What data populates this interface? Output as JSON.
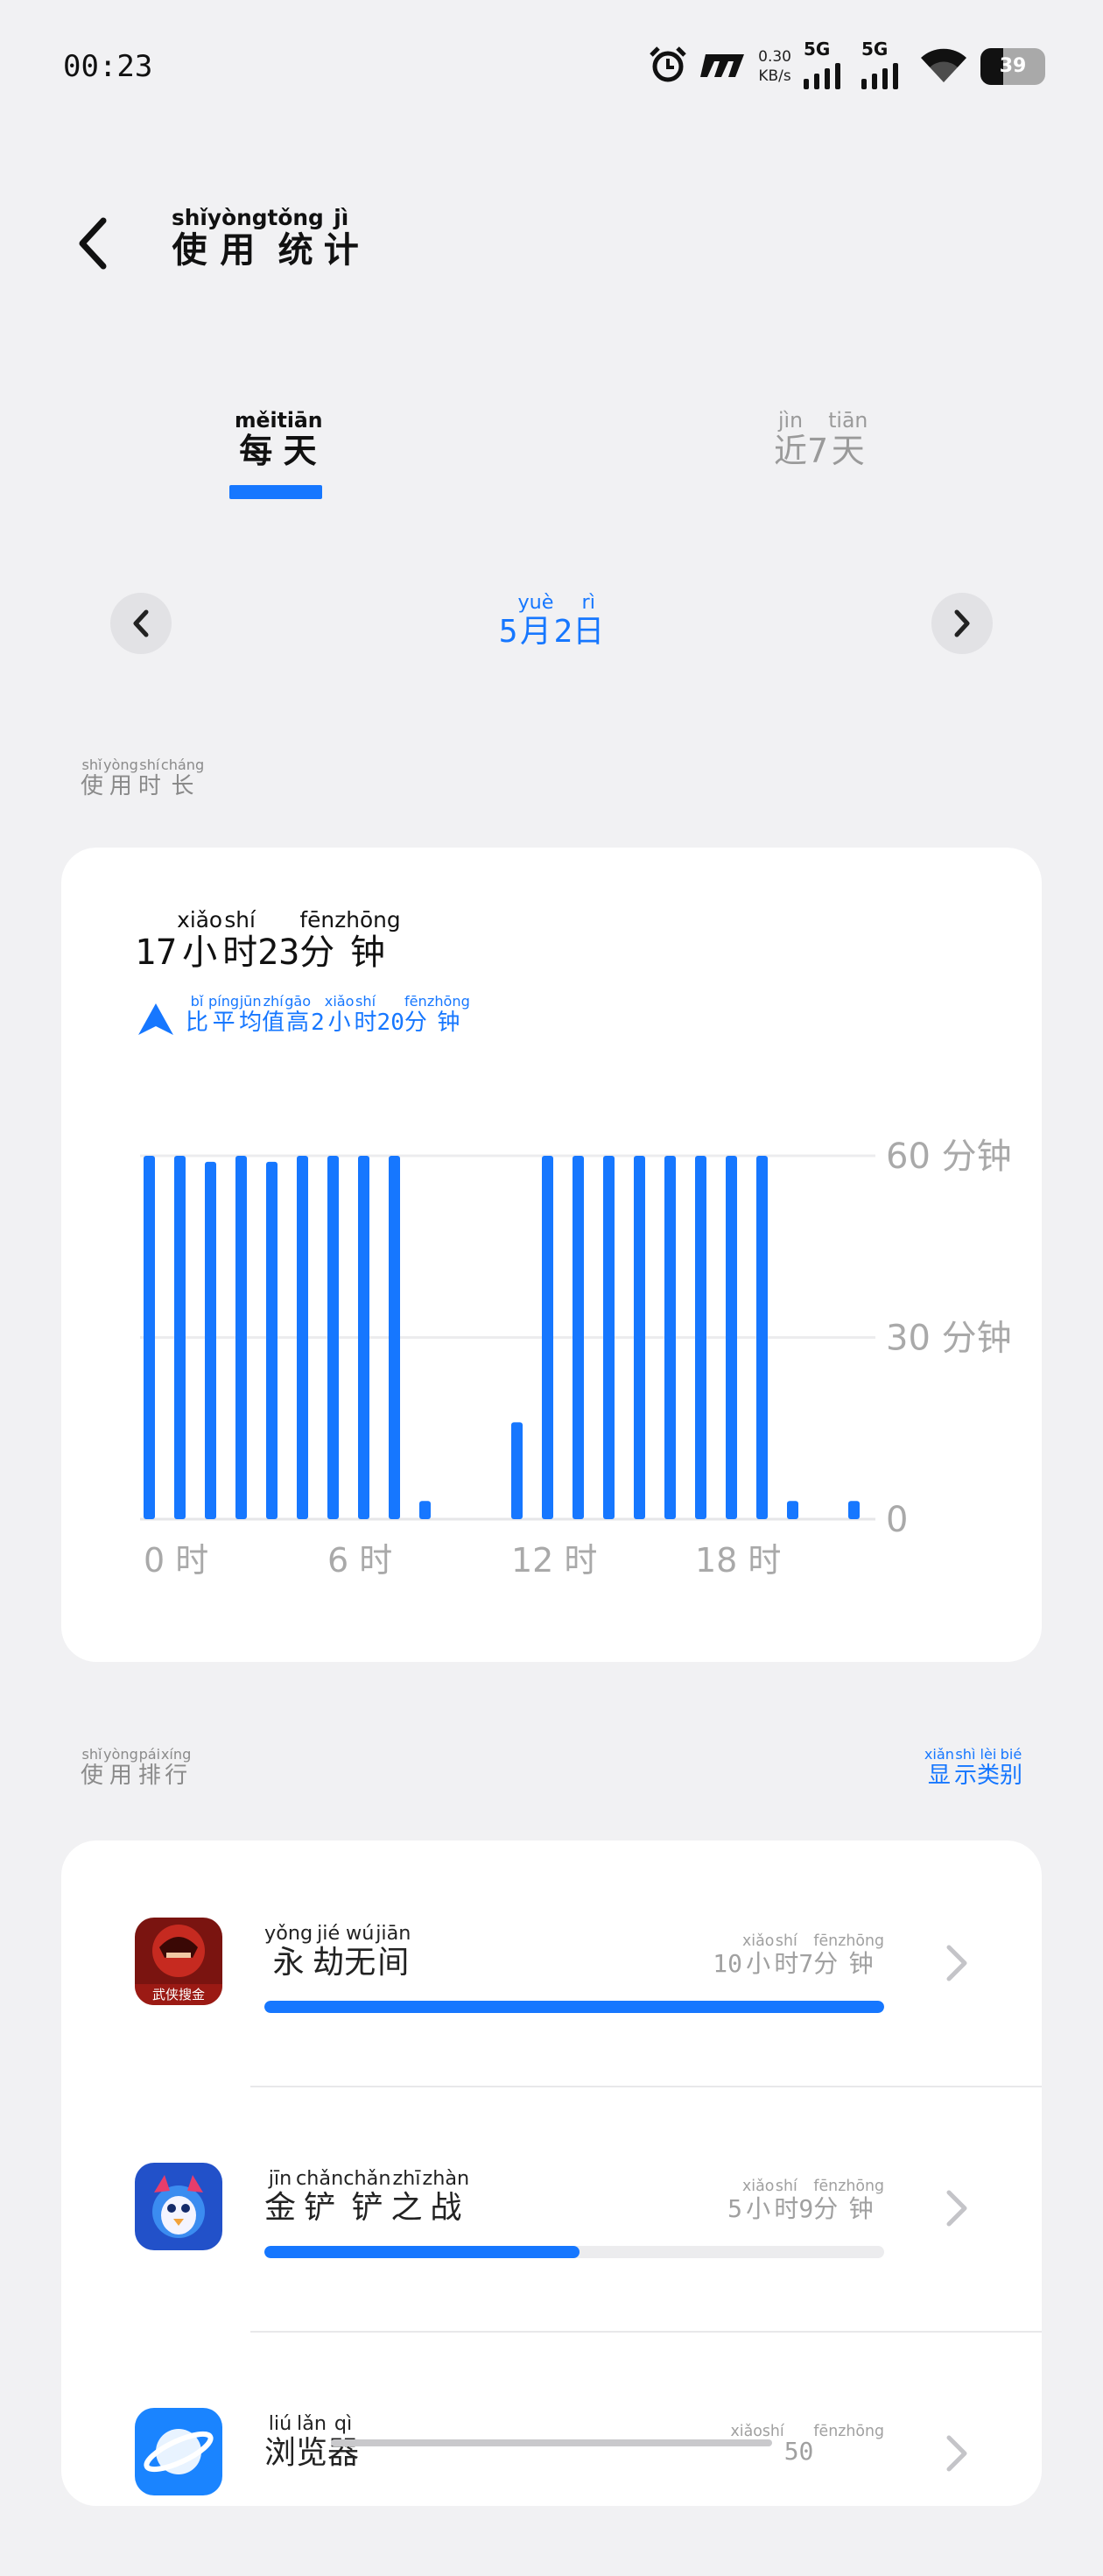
{
  "status_bar": {
    "time": "00:23",
    "net_speed_value": "0.30",
    "net_speed_unit": "KB/s",
    "signal1_label": "5G",
    "signal2_label": "5G",
    "battery": "39"
  },
  "header": {
    "title_chars": [
      "使",
      "用",
      "统",
      "计"
    ],
    "title_pinyin": [
      "shǐ",
      "yòng",
      "tǒng",
      "jì"
    ]
  },
  "tabs": [
    {
      "chars": [
        "每",
        "天"
      ],
      "pinyin": [
        "měi",
        "tiān"
      ],
      "active": true
    },
    {
      "chars": [
        "近",
        "7",
        "天"
      ],
      "pinyin": [
        "jìn",
        "",
        "tiān"
      ],
      "active": false
    }
  ],
  "date_nav": {
    "parts": [
      {
        "t": "5",
        "p": ""
      },
      {
        "t": "月",
        "p": "yuè"
      },
      {
        "t": "2",
        "p": ""
      },
      {
        "t": "日",
        "p": "rì"
      }
    ]
  },
  "usage_section": {
    "label": [
      {
        "t": "使",
        "p": "shǐ"
      },
      {
        "t": "用",
        "p": "yòng"
      },
      {
        "t": "时",
        "p": "shí"
      },
      {
        "t": "长",
        "p": "cháng"
      }
    ],
    "total": [
      {
        "t": "17",
        "p": ""
      },
      {
        "t": "小",
        "p": "xiǎo"
      },
      {
        "t": "时",
        "p": "shí"
      },
      {
        "t": "23",
        "p": ""
      },
      {
        "t": "分",
        "p": "fēn"
      },
      {
        "t": "钟",
        "p": "zhōng"
      }
    ],
    "compare": [
      {
        "t": "比",
        "p": "bǐ"
      },
      {
        "t": "平",
        "p": "píng"
      },
      {
        "t": "均",
        "p": "jūn"
      },
      {
        "t": "值",
        "p": "zhí"
      },
      {
        "t": "高",
        "p": "gāo"
      },
      {
        "t": "2",
        "p": ""
      },
      {
        "t": "小",
        "p": "xiǎo"
      },
      {
        "t": "时",
        "p": "shí"
      },
      {
        "t": "20",
        "p": ""
      },
      {
        "t": "分",
        "p": "fēn"
      },
      {
        "t": "钟",
        "p": "zhōng"
      }
    ],
    "compare_direction": "up"
  },
  "chart_data": {
    "type": "bar",
    "categories": [
      "0",
      "1",
      "2",
      "3",
      "4",
      "5",
      "6",
      "7",
      "8",
      "9",
      "10",
      "11",
      "12",
      "13",
      "14",
      "15",
      "16",
      "17",
      "18",
      "19",
      "20",
      "21",
      "22",
      "23"
    ],
    "values": [
      60,
      60,
      59,
      60,
      59,
      60,
      60,
      60,
      60,
      3,
      0,
      0,
      16,
      60,
      60,
      60,
      60,
      60,
      60,
      60,
      60,
      3,
      0,
      3
    ],
    "y_tick_labels": [
      "60 分钟",
      "30 分钟",
      "0"
    ],
    "y_ticks": [
      60,
      30,
      0
    ],
    "x_tick_labels": [
      "0 时",
      "6 时",
      "12 时",
      "18 时"
    ],
    "x_tick_positions": [
      0,
      6,
      12,
      18
    ],
    "ylim": [
      0,
      60
    ],
    "bar_color": "#1677ff",
    "grid": true
  },
  "ranking_section": {
    "label": [
      {
        "t": "使",
        "p": "shǐ"
      },
      {
        "t": "用",
        "p": "yòng"
      },
      {
        "t": "排",
        "p": "pái"
      },
      {
        "t": "行",
        "p": "xíng"
      }
    ],
    "action": [
      {
        "t": "显",
        "p": "xiǎn"
      },
      {
        "t": "示",
        "p": "shì"
      },
      {
        "t": "类",
        "p": "lèi"
      },
      {
        "t": "别",
        "p": "bié"
      }
    ]
  },
  "apps": [
    {
      "name": [
        {
          "t": "永",
          "p": "yǒng"
        },
        {
          "t": "劫",
          "p": "jié"
        },
        {
          "t": "无",
          "p": "wú"
        },
        {
          "t": "间",
          "p": "jiān"
        }
      ],
      "time": [
        {
          "t": "10",
          "p": ""
        },
        {
          "t": "小",
          "p": "xiǎo"
        },
        {
          "t": "时",
          "p": "shí"
        },
        {
          "t": "7",
          "p": ""
        },
        {
          "t": "分",
          "p": "fēn"
        },
        {
          "t": "钟",
          "p": "zhōng"
        }
      ],
      "minutes": 607,
      "icon": "naraka-app-icon",
      "icon_caption": "武侠搜金"
    },
    {
      "name": [
        {
          "t": "金",
          "p": "jīn"
        },
        {
          "t": "铲",
          "p": "chǎn"
        },
        {
          "t": "铲",
          "p": "chǎn"
        },
        {
          "t": "之",
          "p": "zhī"
        },
        {
          "t": "战",
          "p": "zhàn"
        }
      ],
      "time": [
        {
          "t": "5",
          "p": ""
        },
        {
          "t": "小",
          "p": "xiǎo"
        },
        {
          "t": "时",
          "p": "shí"
        },
        {
          "t": "9",
          "p": ""
        },
        {
          "t": "分",
          "p": "fēn"
        },
        {
          "t": "钟",
          "p": "zhōng"
        }
      ],
      "minutes": 309,
      "icon": "tft-app-icon"
    },
    {
      "name": [
        {
          "t": "浏",
          "p": "liú"
        },
        {
          "t": "览",
          "p": "lǎn"
        },
        {
          "t": "器",
          "p": "qì"
        }
      ],
      "time": [
        {
          "t": "",
          "p": "xiǎo"
        },
        {
          "t": "",
          "p": "shí"
        },
        {
          "t": "50",
          "p": ""
        },
        {
          "t": "",
          "p": "fēn"
        },
        {
          "t": "",
          "p": "zhōng"
        }
      ],
      "minutes": 0,
      "icon": "browser-app-icon"
    }
  ]
}
